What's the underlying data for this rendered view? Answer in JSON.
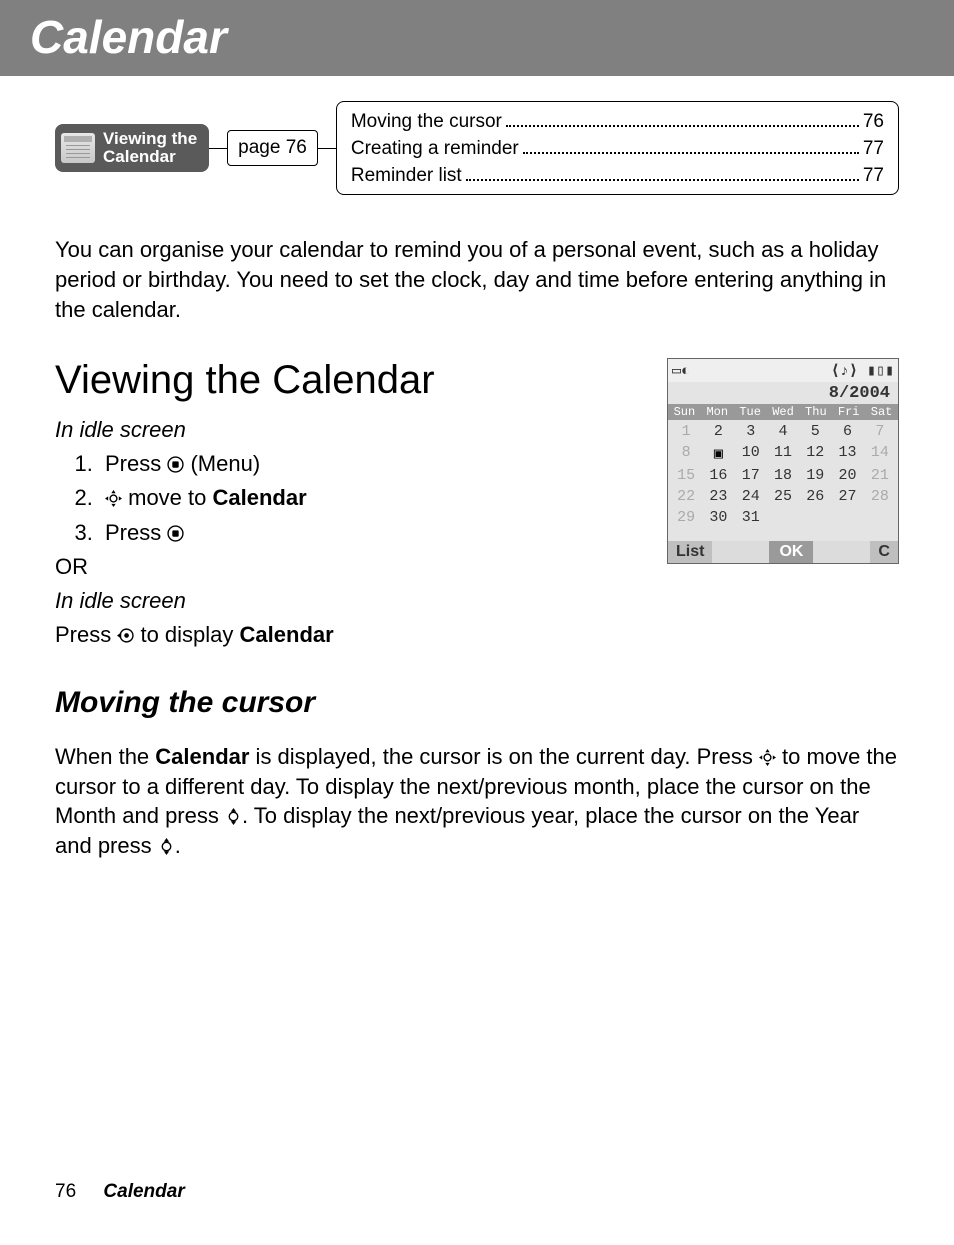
{
  "banner": {
    "title": "Calendar"
  },
  "chip": {
    "line1": "Viewing the",
    "line2": "Calendar"
  },
  "pageBox": "page 76",
  "toc": [
    {
      "label": "Moving the cursor",
      "page": "76"
    },
    {
      "label": "Creating a reminder",
      "page": "77"
    },
    {
      "label": "Reminder list",
      "page": "77"
    }
  ],
  "intro": "You can organise your calendar to remind you of a personal event, such as a holiday period or birthday. You need to set the clock, day and time before entering anything in the calendar.",
  "section1": {
    "heading": "Viewing the Calendar",
    "idle1": "In idle screen",
    "step1a": "Press ",
    "step1b": " (Menu)",
    "step2a": " move to ",
    "step2b": "Calendar",
    "step3": "Press ",
    "or": "OR",
    "idle2": "In idle screen",
    "pressA": "Press ",
    "pressB": " to display ",
    "pressC": "Calendar"
  },
  "phone": {
    "month": "8/2004",
    "dow": [
      "Sun",
      "Mon",
      "Tue",
      "Wed",
      "Thu",
      "Fri",
      "Sat"
    ],
    "days": [
      [
        "1",
        "dim"
      ],
      [
        "2",
        ""
      ],
      [
        "3",
        ""
      ],
      [
        "4",
        ""
      ],
      [
        "5",
        ""
      ],
      [
        "6",
        ""
      ],
      [
        "7",
        "dim"
      ],
      [
        "8",
        "dim"
      ],
      [
        "9",
        "mark"
      ],
      [
        "10",
        ""
      ],
      [
        "11",
        ""
      ],
      [
        "12",
        ""
      ],
      [
        "13",
        ""
      ],
      [
        "14",
        "dim"
      ],
      [
        "15",
        "dim"
      ],
      [
        "16",
        ""
      ],
      [
        "17",
        ""
      ],
      [
        "18",
        ""
      ],
      [
        "19",
        ""
      ],
      [
        "20",
        ""
      ],
      [
        "21",
        "dim"
      ],
      [
        "22",
        "dim"
      ],
      [
        "23",
        ""
      ],
      [
        "24",
        ""
      ],
      [
        "25",
        ""
      ],
      [
        "26",
        ""
      ],
      [
        "27",
        ""
      ],
      [
        "28",
        "dim"
      ],
      [
        "29",
        "dim"
      ],
      [
        "30",
        ""
      ],
      [
        "31",
        ""
      ]
    ],
    "softLeft": "List",
    "softCenter": "OK",
    "softRight": "C"
  },
  "section2": {
    "heading": "Moving the cursor",
    "p1": "When the ",
    "p2": "Calendar",
    "p3": " is displayed, the cursor is on the current day. Press ",
    "p4": " to move the cursor to a different day. To display the next/previous month, place the cursor on the Month and press ",
    "p5": ". To display the next/previous year, place the cursor on the Year and press ",
    "p6": "."
  },
  "footer": {
    "page": "76",
    "title": "Calendar"
  }
}
